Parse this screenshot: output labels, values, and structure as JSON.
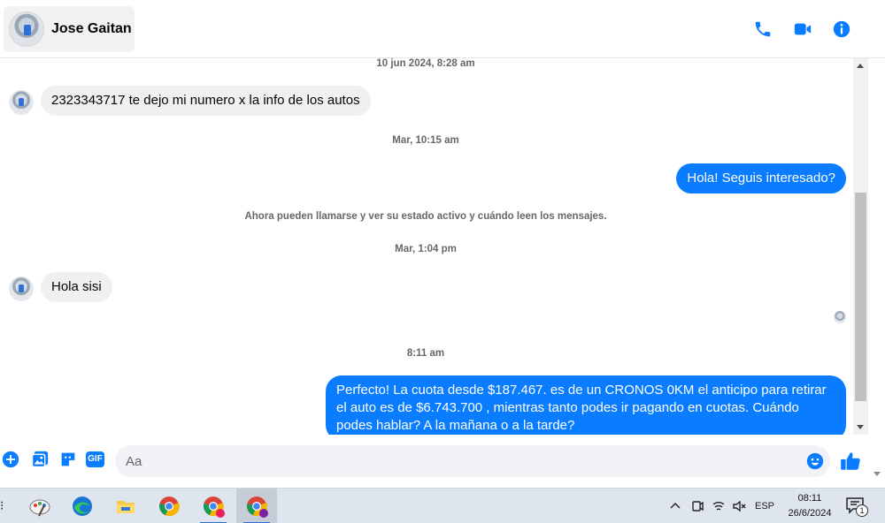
{
  "header": {
    "contact_name": "Jose Gaitan",
    "icons": [
      "phone-icon",
      "video-icon",
      "info-icon"
    ]
  },
  "colors": {
    "accent": "#0a7cff",
    "incoming_bubble": "#f0f0f0",
    "taskbar": "#dfe5ee"
  },
  "chat": {
    "ts1": "10 jun 2024, 8:28 am",
    "msg1": "2323343717 te dejo mi numero x la info de los autos",
    "ts2": "Mar, 10:15 am",
    "msg2": "Hola! Seguis interesado?",
    "system_note": "Ahora pueden llamarse y ver su estado activo y cuándo leen los mensajes.",
    "ts3": "Mar, 1:04 pm",
    "msg3": "Hola sisi",
    "ts4": "8:11 am",
    "msg4": "Perfecto! La cuota desde $187.467. es de un CRONOS 0KM el anticipo para retirar el auto es de $6.743.700 , mientras tanto podes ir pagando en cuotas. Cuándo podes hablar? A la mañana o a la tarde?"
  },
  "composer": {
    "placeholder": "Aa",
    "gif_label": "GIF"
  },
  "taskbar": {
    "apps": [
      "paint-app-icon",
      "edge-browser-icon",
      "file-explorer-icon",
      "chrome-icon",
      "chrome-profile-icon",
      "chrome-profile-2-icon"
    ],
    "language": "ESP",
    "time": "08:11",
    "date": "26/6/2024",
    "notification_count": "1"
  }
}
